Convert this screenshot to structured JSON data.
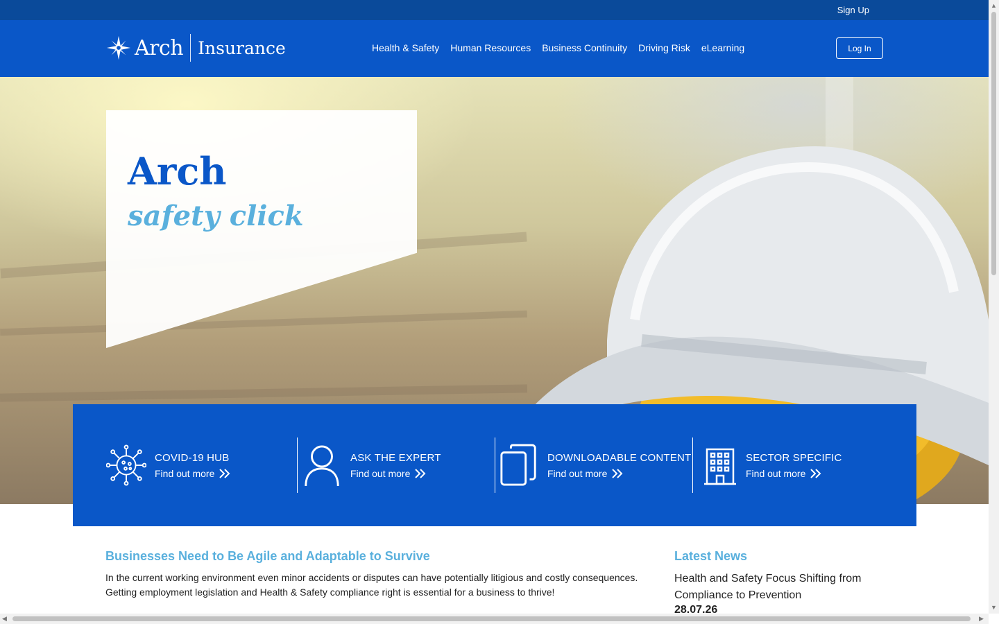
{
  "topbar": {
    "signup_label": "Sign Up"
  },
  "brand": {
    "name_left": "Arch",
    "name_right": "Insurance"
  },
  "nav": {
    "items": [
      "Health & Safety",
      "Human Resources",
      "Business Continuity",
      "Driving Risk",
      "eLearning"
    ],
    "login_label": "Log In"
  },
  "hero": {
    "title": "Arch",
    "subtitle": "safety click"
  },
  "features": [
    {
      "title": "COVID-19 HUB",
      "link": "Find out more",
      "icon": "virus-icon"
    },
    {
      "title": "ASK THE EXPERT",
      "link": "Find out more",
      "icon": "person-icon"
    },
    {
      "title": "DOWNLOADABLE CONTENT",
      "link": "Find out more",
      "icon": "documents-icon"
    },
    {
      "title": "SECTOR SPECIFIC",
      "link": "Find out more",
      "icon": "building-icon"
    }
  ],
  "intro": {
    "heading": "Businesses Need to Be Agile and Adaptable to Survive",
    "line1": "In the current working environment even minor accidents or disputes can have potentially litigious and costly consequences.",
    "line2": "Getting employment legislation and Health & Safety compliance right is essential for a business to thrive!"
  },
  "news": {
    "heading": "Latest News",
    "headline": "Health and Safety Focus Shifting from Compliance to Prevention",
    "date": "28.07.26"
  },
  "colors": {
    "brand_blue": "#0a57c8",
    "topbar_blue": "#0a4a9a",
    "accent_light_blue": "#5ab0dd"
  }
}
